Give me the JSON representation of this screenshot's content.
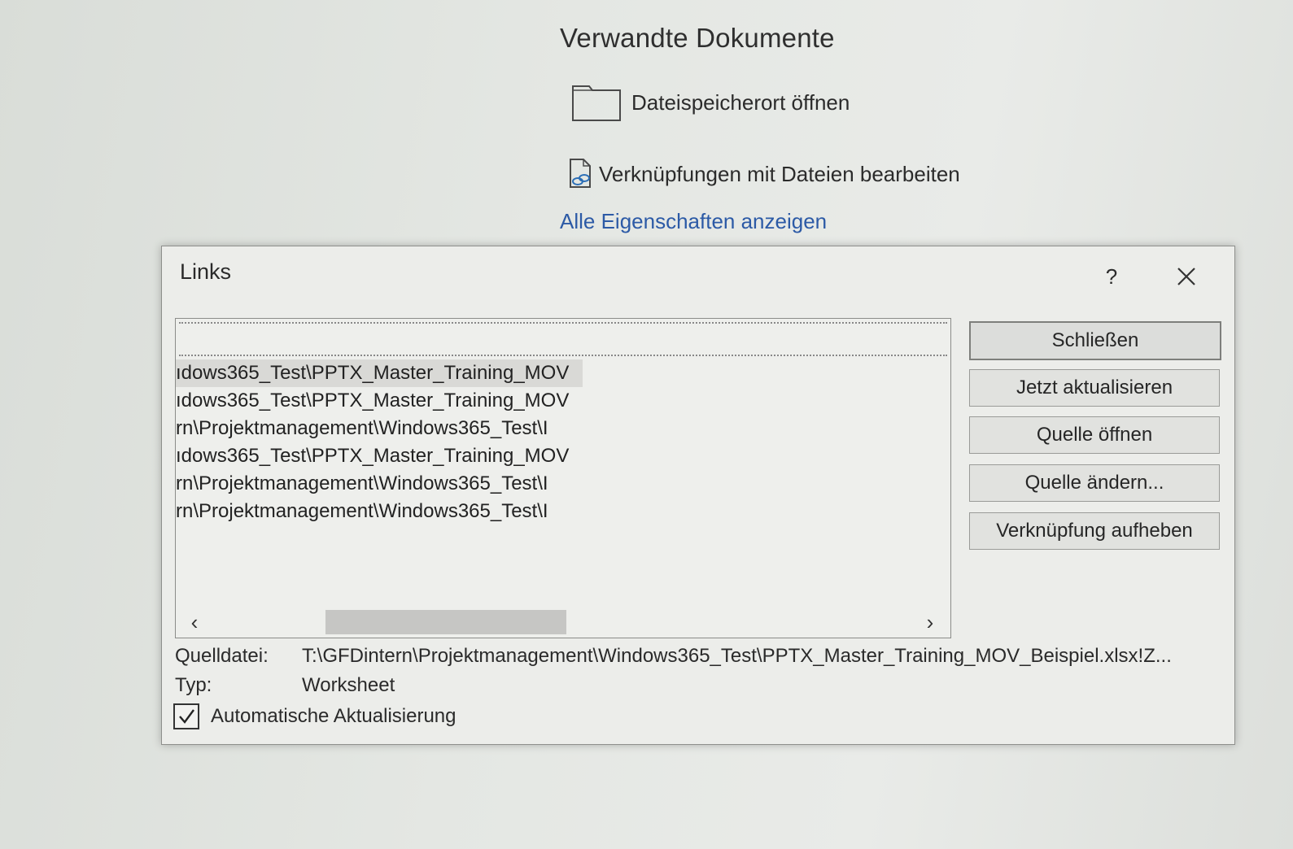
{
  "backstage": {
    "section_title": "Verwandte Dokumente",
    "open_location_label": "Dateispeicherort öffnen",
    "edit_links_label": "Verknüpfungen mit Dateien bearbeiten",
    "all_properties_link": "Alle Eigenschaften anzeigen"
  },
  "dialog": {
    "title": "Links",
    "help_label": "?",
    "links": [
      "ıdows365_Test\\PPTX_Master_Training_MOV",
      "ıdows365_Test\\PPTX_Master_Training_MOV",
      "rn\\Projektmanagement\\Windows365_Test\\I",
      "ıdows365_Test\\PPTX_Master_Training_MOV",
      "rn\\Projektmanagement\\Windows365_Test\\I",
      "rn\\Projektmanagement\\Windows365_Test\\I"
    ],
    "selected_index": 0,
    "scroll_left": "‹",
    "scroll_right": "›",
    "buttons": {
      "close": "Schließen",
      "update_now": "Jetzt aktualisieren",
      "open_source": "Quelle öffnen",
      "change_source": "Quelle ändern...",
      "break_link": "Verknüpfung aufheben"
    },
    "source_label": "Quelldatei:",
    "source_value": "T:\\GFDintern\\Projektmanagement\\Windows365_Test\\PPTX_Master_Training_MOV_Beispiel.xlsx!Z...",
    "type_label": "Typ:",
    "type_value": "Worksheet",
    "auto_update_label": "Automatische Aktualisierung",
    "auto_update_checked": true
  }
}
